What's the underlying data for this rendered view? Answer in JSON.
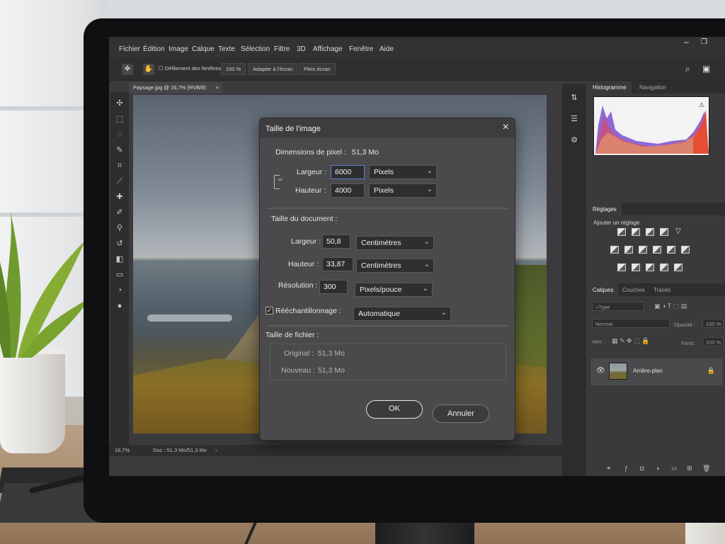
{
  "menubar": {
    "items": [
      "Fichier",
      "Édition",
      "Image",
      "Calque",
      "Texte",
      "Sélection",
      "Filtre",
      "3D",
      "Affichage",
      "Fenêtre",
      "Aide"
    ]
  },
  "optbar": {
    "scroll_all_label": "Défilement des fenêtres",
    "zoom_label": "100 %",
    "fit_label": "Adapter à l'écran",
    "fullscreen_label": "Plein écran"
  },
  "document": {
    "tab_label": "Paysage.jpg @ 16,7% (RVB/8)",
    "tab_close": "×"
  },
  "statusbar": {
    "zoom": "16,7%",
    "doc_info": "Doc : 51,3 Mo/51,3 Mo"
  },
  "panels": {
    "histogram_tab": "Histogramme",
    "navigation_tab": "Navigation",
    "adjustments_tab": "Réglages",
    "add_adjustment": "Ajouter un réglage",
    "layers_tab": "Calques",
    "channels_tab": "Couches",
    "paths_tab": "Tracés",
    "kind_filter": "Type",
    "blend_mode": "Normal",
    "opacity_label": "Opacité :",
    "opacity_value": "100 %",
    "lock_label": "Verr. :",
    "fill_label": "Fond :",
    "fill_value": "100 %",
    "layer_name": "Arrière-plan"
  },
  "dialog": {
    "title": "Taille de l'image",
    "close": "×",
    "pixel_dimensions_label": "Dimensions de pixel :",
    "pixel_dimensions_value": "51,3 Mo",
    "px_width_label": "Largeur :",
    "px_width_value": "6000",
    "px_width_unit": "Pixels",
    "px_height_label": "Hauteur :",
    "px_height_value": "4000",
    "px_height_unit": "Pixels",
    "document_size_label": "Taille du document :",
    "doc_width_label": "Largeur :",
    "doc_width_value": "50,8",
    "doc_width_unit": "Centimètres",
    "doc_height_label": "Hauteur :",
    "doc_height_value": "33,87",
    "doc_height_unit": "Centimètres",
    "resolution_label": "Résolution :",
    "resolution_value": "300",
    "resolution_unit": "Pixels/pouce",
    "resample_label": "Rééchantillonnage :",
    "resample_checked": "✓",
    "resample_value": "Automatique",
    "file_size_label": "Taille de fichier :",
    "original_label": "Original :",
    "original_value": "51,3 Mo",
    "new_label": "Nouveau :",
    "new_value": "51,3 Mo",
    "ok_label": "OK",
    "cancel_label": "Annuler"
  }
}
